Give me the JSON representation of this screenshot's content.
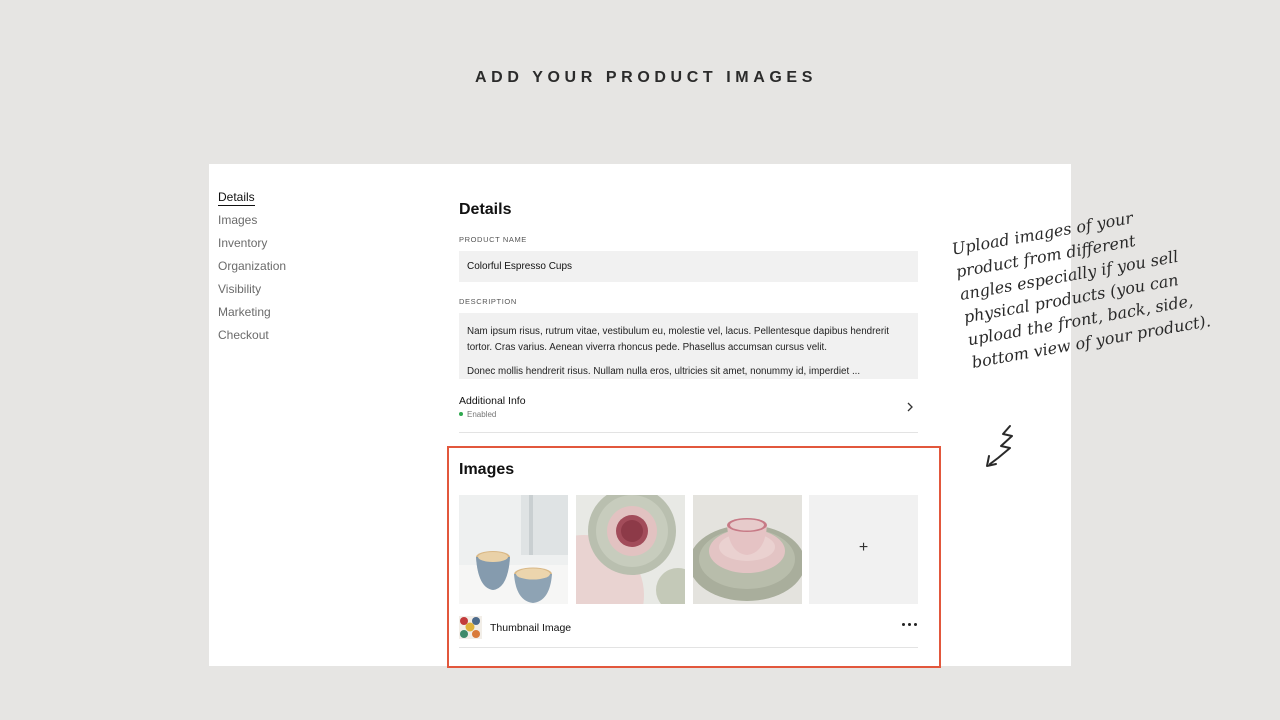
{
  "headline": "ADD YOUR PRODUCT IMAGES",
  "side_nav": {
    "items": [
      {
        "label": "Details",
        "active": true
      },
      {
        "label": "Images",
        "active": false
      },
      {
        "label": "Inventory",
        "active": false
      },
      {
        "label": "Organization",
        "active": false
      },
      {
        "label": "Visibility",
        "active": false
      },
      {
        "label": "Marketing",
        "active": false
      },
      {
        "label": "Checkout",
        "active": false
      }
    ]
  },
  "details": {
    "title": "Details",
    "product_name_label": "PRODUCT NAME",
    "product_name_value": "Colorful Espresso Cups",
    "description_label": "DESCRIPTION",
    "description_p1": "Nam ipsum risus, rutrum vitae, vestibulum eu, molestie vel, lacus. Pellentesque dapibus hendrerit tortor. Cras varius. Aenean viverra rhoncus pede. Phasellus accumsan cursus velit.",
    "description_p2": "Donec mollis hendrerit risus. Nullam nulla eros, ultricies sit amet, nonummy id, imperdiet ...",
    "additional_info_title": "Additional Info",
    "additional_info_status": "Enabled"
  },
  "images": {
    "title": "Images",
    "thumbnails": [
      "blue-latte-cups-photo",
      "pink-cup-top-view-photo",
      "pink-cup-side-view-photo"
    ],
    "add_symbol": "+",
    "thumbnail_label": "Thumbnail Image"
  },
  "annotation": {
    "lines": [
      "Upload images of your",
      "product from different",
      "angles especially if you sell",
      "physical products (you can",
      "upload the front, back, side,",
      "bottom view of your product)."
    ]
  },
  "colors": {
    "background": "#e6e5e3",
    "highlight_border": "#e2573c",
    "status_dot": "#2fa84f",
    "field_bg": "#f1f1f1"
  },
  "icons": [
    "chevron-right-icon",
    "plus-icon",
    "more-dots-icon",
    "squiggle-arrow-icon"
  ]
}
